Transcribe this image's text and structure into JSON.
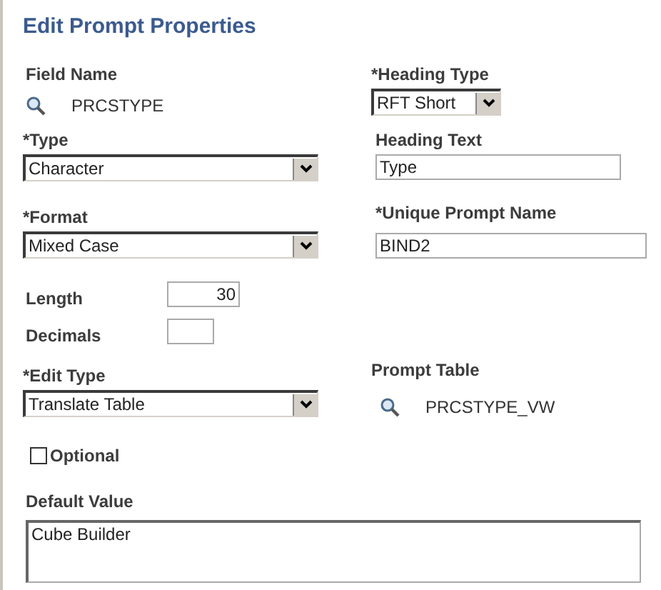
{
  "title": "Edit Prompt Properties",
  "field_name": {
    "label": "Field Name",
    "value": "PRCSTYPE"
  },
  "heading_type": {
    "label": "*Heading Type",
    "value": "RFT Short"
  },
  "type": {
    "label": "*Type",
    "value": "Character"
  },
  "heading_text": {
    "label": "Heading Text",
    "value": "Type"
  },
  "format": {
    "label": "*Format",
    "value": "Mixed Case"
  },
  "unique_prompt_name": {
    "label": "*Unique Prompt Name",
    "value": "BIND2"
  },
  "length": {
    "label": "Length",
    "value": "30"
  },
  "decimals": {
    "label": "Decimals"
  },
  "edit_type": {
    "label": "*Edit Type",
    "value": "Translate Table"
  },
  "prompt_table": {
    "label": "Prompt Table",
    "value": "PRCSTYPE_VW"
  },
  "optional": {
    "label": "Optional",
    "checked": false
  },
  "default_value": {
    "label": "Default Value",
    "value": "Cube Builder"
  }
}
